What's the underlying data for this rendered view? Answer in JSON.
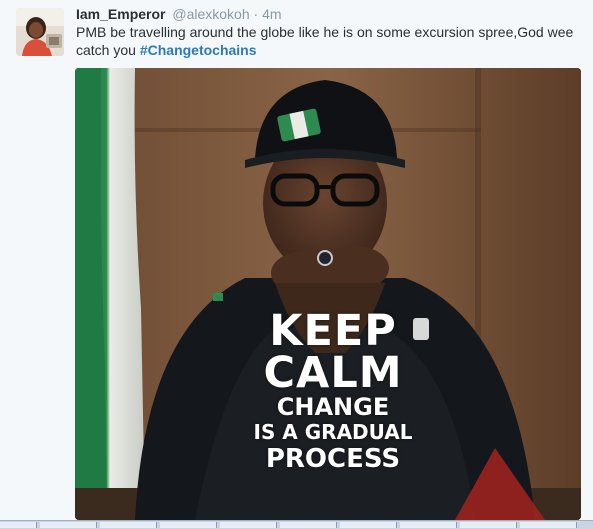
{
  "tweet": {
    "display_name": "Iam_Emperor",
    "handle": "@alexkokoh",
    "separator": "·",
    "time": "4m",
    "text_before": "PMB be travelling around the globe like he is on some excursion spree,God wee catch you ",
    "hashtag": "#Changetochains"
  },
  "image": {
    "line1": "KEEP",
    "line2": "CALM",
    "line3": "CHANGE",
    "line4": "IS A GRADUAL",
    "line5": "PROCESS"
  },
  "colors": {
    "hashtag": "#2b7bb9",
    "name": "#292f33",
    "muted": "#8899a6",
    "background": "#f5f8fa"
  },
  "icons": {
    "avatar": "profile-photo",
    "taskbar": "windows-taskbar"
  }
}
